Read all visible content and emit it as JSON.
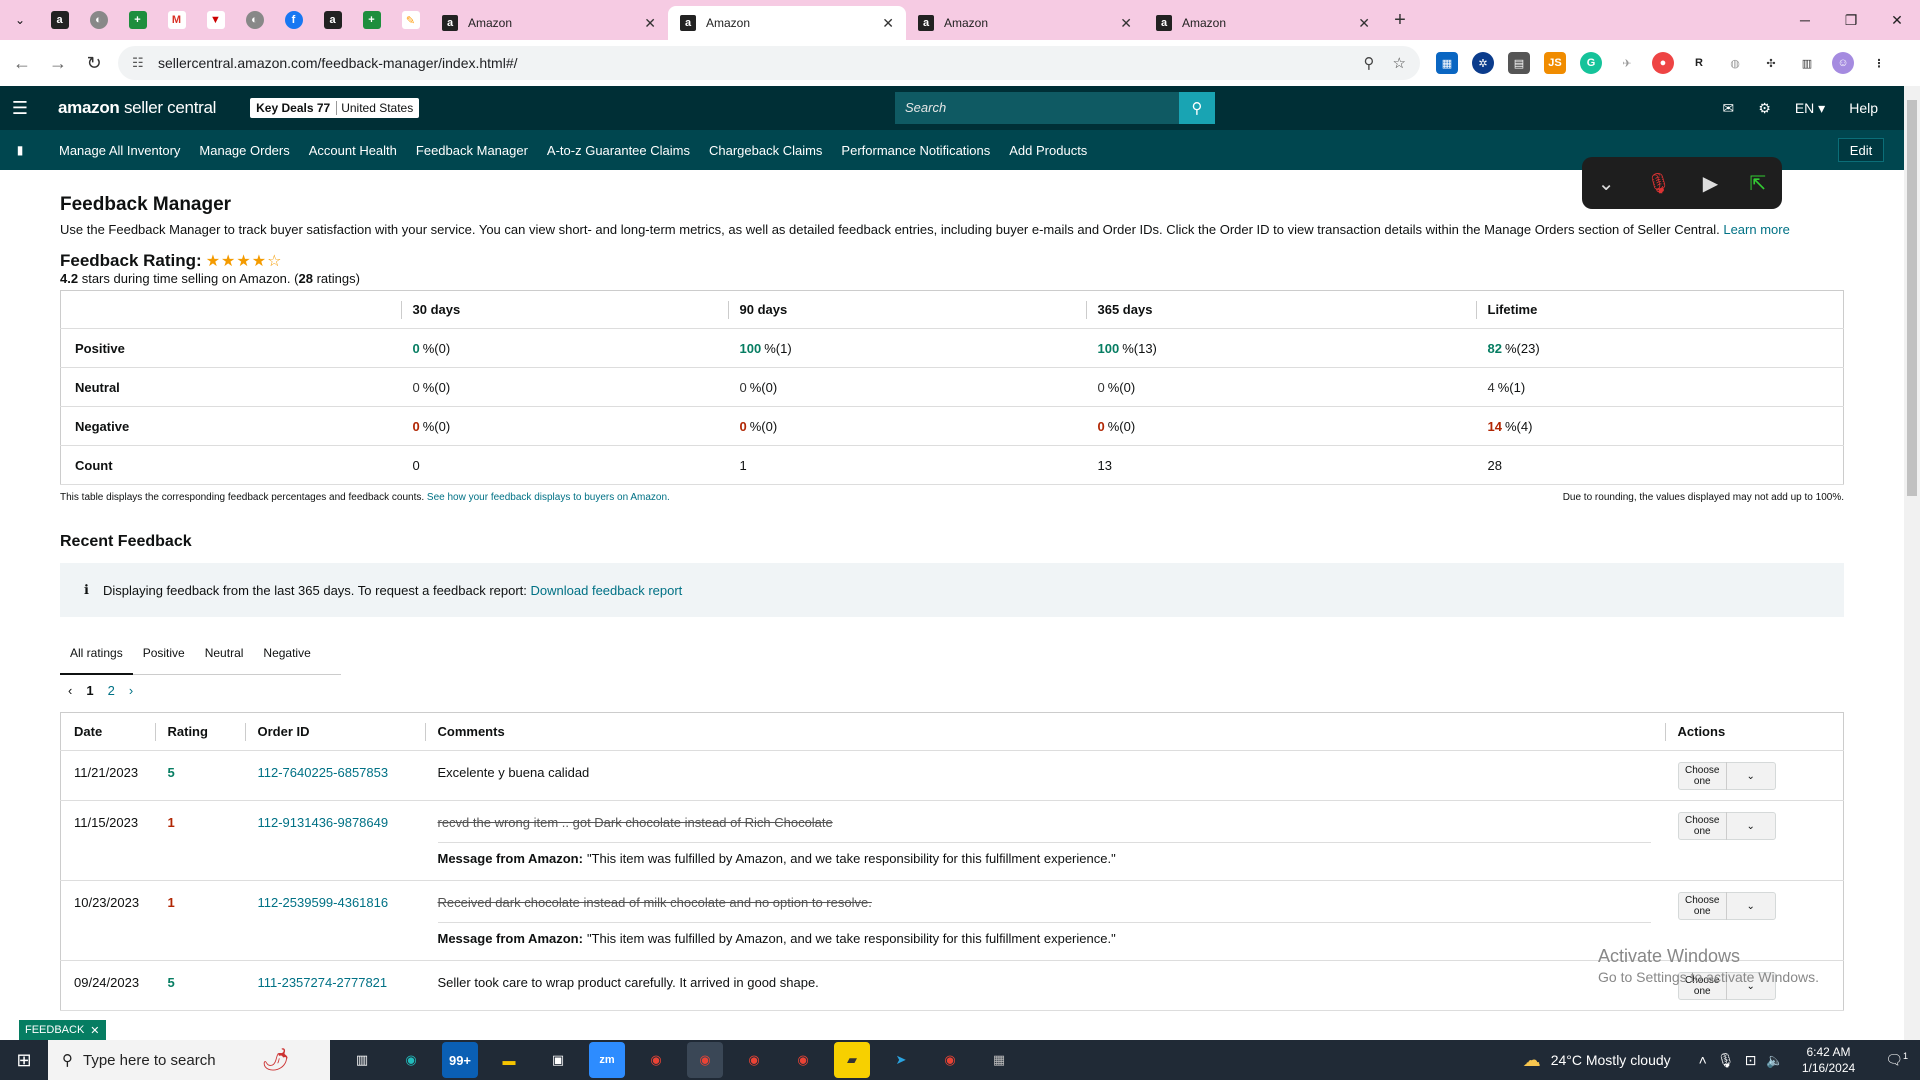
{
  "browser": {
    "tabs": [
      {
        "title": "Amazon"
      },
      {
        "title": "Amazon"
      },
      {
        "title": "Amazon"
      },
      {
        "title": "Amazon"
      }
    ],
    "url": "sellercentral.amazon.com/feedback-manager/index.html#/"
  },
  "header": {
    "logo": "amazon",
    "logo_suffix": "seller central",
    "store_name": "Key Deals 77",
    "store_region": "United States",
    "search_placeholder": "Search",
    "lang": "EN",
    "help": "Help"
  },
  "nav": {
    "items": [
      "Manage All Inventory",
      "Manage Orders",
      "Account Health",
      "Feedback Manager",
      "A-to-z Guarantee Claims",
      "Chargeback Claims",
      "Performance Notifications",
      "Add Products"
    ],
    "edit": "Edit"
  },
  "page": {
    "title": "Feedback Manager",
    "intro": "Use the Feedback Manager to track buyer satisfaction with your service. You can view short- and long-term metrics, as well as detailed feedback entries, including buyer e-mails and Order IDs. Click the Order ID to view transaction details within the Manage Orders section of Seller Central.",
    "learn_more": "Learn more",
    "rating_title": "Feedback Rating:",
    "rating_value": 4.2,
    "rating_stars_text": "4.2",
    "rating_suffix": "stars during time selling on Amazon. (",
    "rating_count": "28",
    "rating_count_suffix": "ratings)"
  },
  "metrics": {
    "columns": [
      "",
      "30 days",
      "90 days",
      "365 days",
      "Lifetime"
    ],
    "rows": [
      {
        "label": "Positive",
        "cells": [
          {
            "pct": "0",
            "cnt": "%(0)",
            "tone": "green"
          },
          {
            "pct": "100",
            "cnt": "%(1)",
            "tone": "green"
          },
          {
            "pct": "100",
            "cnt": "%(13)",
            "tone": "green"
          },
          {
            "pct": "82",
            "cnt": "%(23)",
            "tone": "green"
          }
        ]
      },
      {
        "label": "Neutral",
        "cells": [
          {
            "pct": "0",
            "cnt": "%(0)",
            "tone": "gray"
          },
          {
            "pct": "0",
            "cnt": "%(0)",
            "tone": "gray"
          },
          {
            "pct": "0",
            "cnt": "%(0)",
            "tone": "gray"
          },
          {
            "pct": "4",
            "cnt": "%(1)",
            "tone": "gray"
          }
        ]
      },
      {
        "label": "Negative",
        "cells": [
          {
            "pct": "0",
            "cnt": "%(0)",
            "tone": "red"
          },
          {
            "pct": "0",
            "cnt": "%(0)",
            "tone": "red"
          },
          {
            "pct": "0",
            "cnt": "%(0)",
            "tone": "red"
          },
          {
            "pct": "14",
            "cnt": "%(4)",
            "tone": "red"
          }
        ]
      },
      {
        "label": "Count",
        "cells": [
          {
            "pct": "0",
            "cnt": "",
            "tone": "plain"
          },
          {
            "pct": "1",
            "cnt": "",
            "tone": "plain"
          },
          {
            "pct": "13",
            "cnt": "",
            "tone": "plain"
          },
          {
            "pct": "28",
            "cnt": "",
            "tone": "plain"
          }
        ]
      }
    ],
    "note_left": "This table displays the corresponding feedback percentages and feedback counts.",
    "note_link": "See how your feedback displays to buyers on Amazon.",
    "note_right": "Due to rounding, the values displayed may not add up to 100%."
  },
  "recent": {
    "title": "Recent Feedback",
    "info_text": "Displaying feedback from the last 365 days. To request a feedback report:",
    "info_link": "Download feedback report",
    "tabs": [
      "All ratings",
      "Positive",
      "Neutral",
      "Negative"
    ],
    "pages": [
      "1",
      "2"
    ],
    "columns": [
      "Date",
      "Rating",
      "Order ID",
      "Comments",
      "Actions"
    ],
    "rows": [
      {
        "date": "11/21/2023",
        "rating": "5",
        "tone": "green",
        "order": "112-7640225-6857853",
        "comment": "Excelente y buena calidad",
        "struck": false,
        "message": ""
      },
      {
        "date": "11/15/2023",
        "rating": "1",
        "tone": "red",
        "order": "112-9131436-9878649",
        "comment": "recvd the wrong item .. got Dark chocolate instead of Rich Chocolate",
        "struck": true,
        "message": "\"This item was fulfilled by Amazon, and we take responsibility for this fulfillment experience.\""
      },
      {
        "date": "10/23/2023",
        "rating": "1",
        "tone": "red",
        "order": "112-2539599-4361816",
        "comment": "Received dark chocolate instead of milk chocolate and no option to resolve.",
        "struck": true,
        "message": "\"This item was fulfilled by Amazon, and we take responsibility for this fulfillment experience.\""
      },
      {
        "date": "09/24/2023",
        "rating": "5",
        "tone": "green",
        "order": "111-2357274-2777821",
        "comment": "Seller took care to wrap product carefully. It arrived in good shape.",
        "struck": false,
        "message": ""
      }
    ],
    "message_label": "Message from Amazon:",
    "action_label": "Choose one"
  },
  "watermark": {
    "line1": "Activate Windows",
    "line2": "Go to Settings to activate Windows."
  },
  "feedback_badge": "FEEDBACK",
  "taskbar": {
    "search_placeholder": "Type here to search",
    "weather": "24°C  Mostly cloudy",
    "time": "6:42 AM",
    "date": "1/16/2024",
    "notif_count": "1",
    "mail_badge": "99+"
  }
}
